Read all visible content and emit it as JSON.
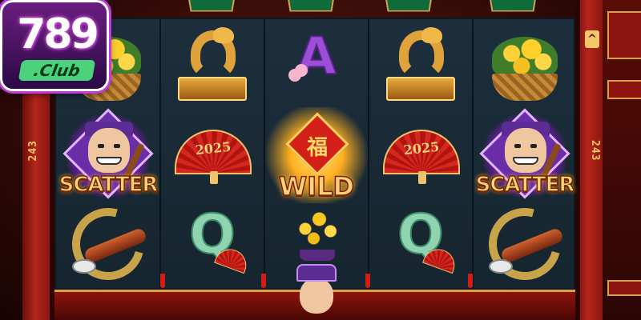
{
  "logo": {
    "number": "789",
    "club": ".Club"
  },
  "frame": {
    "left_counter": "243",
    "right_counter": "243",
    "top_arrow": "^"
  },
  "banners": [
    "",
    "",
    "",
    ""
  ],
  "reels": [
    {
      "symbols": [
        "flower-basket",
        "scatter",
        "ink-roller"
      ]
    },
    {
      "symbols": [
        "golden-dragon",
        "fan",
        "letter-q"
      ]
    },
    {
      "symbols": [
        "letter-a",
        "wild",
        "bonsai"
      ]
    },
    {
      "symbols": [
        "golden-dragon",
        "fan",
        "letter-q"
      ]
    },
    {
      "symbols": [
        "flower-basket",
        "scatter",
        "ink-roller"
      ]
    }
  ],
  "labels": {
    "scatter": "SCATTER",
    "wild": "WILD",
    "fan_year": "2025",
    "letter_a": "A",
    "letter_q": "Q",
    "wild_glyph": "福"
  },
  "colors": {
    "frame_red": "#b3261b",
    "reel_bg": "#1d2f3d",
    "gold": "#f2c76a",
    "logo_purple": "#6a1d80"
  }
}
